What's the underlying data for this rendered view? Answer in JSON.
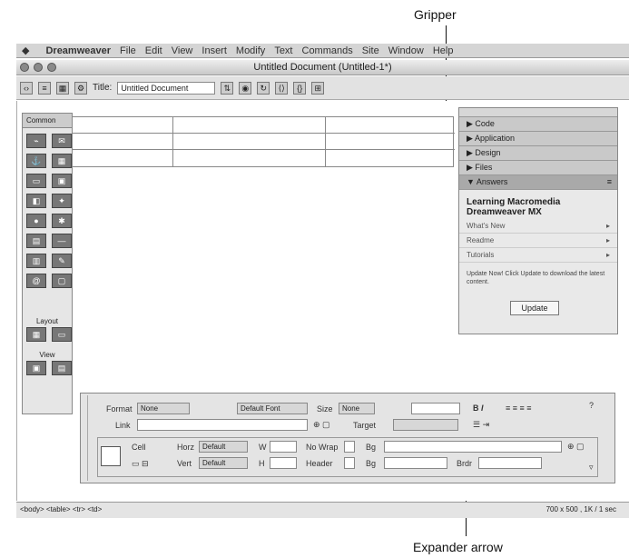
{
  "callouts": {
    "gripper": "Gripper",
    "expander": "Expander arrow"
  },
  "menubar": {
    "app": "Dreamweaver",
    "items": [
      "File",
      "Edit",
      "View",
      "Insert",
      "Modify",
      "Text",
      "Commands",
      "Site",
      "Window",
      "Help"
    ]
  },
  "window": {
    "title": "Untitled Document (Untitled-1*)"
  },
  "toolbar": {
    "title_label": "Title:",
    "title_value": "Untitled Document"
  },
  "insert_bar": {
    "header": "Common",
    "layout_label": "Layout",
    "view_label": "View"
  },
  "panel": {
    "groups": [
      "Code",
      "Application",
      "Design",
      "Files",
      "Answers"
    ],
    "heading": "Learning Macromedia Dreamweaver MX",
    "rows": [
      "What's New",
      "Readme",
      "Tutorials"
    ],
    "update_text": "Update Now! Click Update to download the latest content.",
    "button": "Update"
  },
  "properties": {
    "format_label": "Format",
    "format_value": "None",
    "font_value": "Default Font",
    "size_label": "Size",
    "size_value": "None",
    "link_label": "Link",
    "target_label": "Target",
    "cell_label": "Cell",
    "horz_label": "Horz",
    "horz_value": "Default",
    "vert_label": "Vert",
    "vert_value": "Default",
    "w_label": "W",
    "h_label": "H",
    "nowrap_label": "No Wrap",
    "header_label": "Header",
    "bg_label": "Bg",
    "brdr_label": "Brdr"
  },
  "status": {
    "tags": "<body> <table> <tr> <td>",
    "info": "700 x 500 , 1K / 1 sec"
  }
}
